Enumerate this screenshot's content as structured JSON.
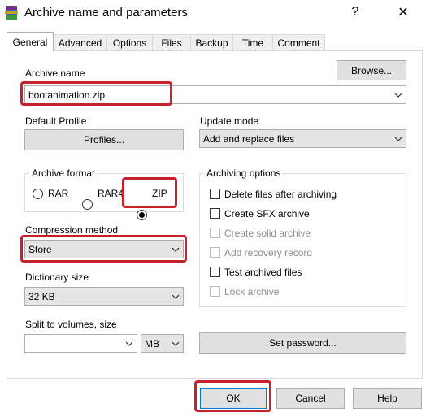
{
  "window": {
    "title": "Archive name and parameters",
    "help_label": "?",
    "close_label": "✕"
  },
  "tabs": [
    {
      "label": "General"
    },
    {
      "label": "Advanced"
    },
    {
      "label": "Options"
    },
    {
      "label": "Files"
    },
    {
      "label": "Backup"
    },
    {
      "label": "Time"
    },
    {
      "label": "Comment"
    }
  ],
  "archive_name": {
    "label": "Archive name",
    "value": "bootanimation.zip",
    "browse_label": "Browse..."
  },
  "default_profile": {
    "label": "Default Profile",
    "profiles_label": "Profiles..."
  },
  "update_mode": {
    "label": "Update mode",
    "value": "Add and replace files"
  },
  "archive_format": {
    "label": "Archive format",
    "options": [
      "RAR",
      "RAR4",
      "ZIP"
    ],
    "selected": "ZIP"
  },
  "compression_method": {
    "label": "Compression method",
    "value": "Store"
  },
  "dictionary_size": {
    "label": "Dictionary size",
    "value": "32 KB"
  },
  "split_volumes": {
    "label": "Split to volumes, size",
    "value": "",
    "unit": "MB"
  },
  "archiving_options": {
    "label": "Archiving options",
    "items": [
      {
        "label": "Delete files after archiving",
        "checked": false,
        "enabled": true
      },
      {
        "label": "Create SFX archive",
        "checked": false,
        "enabled": true
      },
      {
        "label": "Create solid archive",
        "checked": false,
        "enabled": false
      },
      {
        "label": "Add recovery record",
        "checked": false,
        "enabled": false
      },
      {
        "label": "Test archived files",
        "checked": false,
        "enabled": true
      },
      {
        "label": "Lock archive",
        "checked": false,
        "enabled": false
      }
    ]
  },
  "set_password_label": "Set password...",
  "buttons": {
    "ok": "OK",
    "cancel": "Cancel",
    "help": "Help"
  },
  "colors": {
    "highlight": "#c8202c",
    "selected_text_bg": "#ffffff"
  }
}
